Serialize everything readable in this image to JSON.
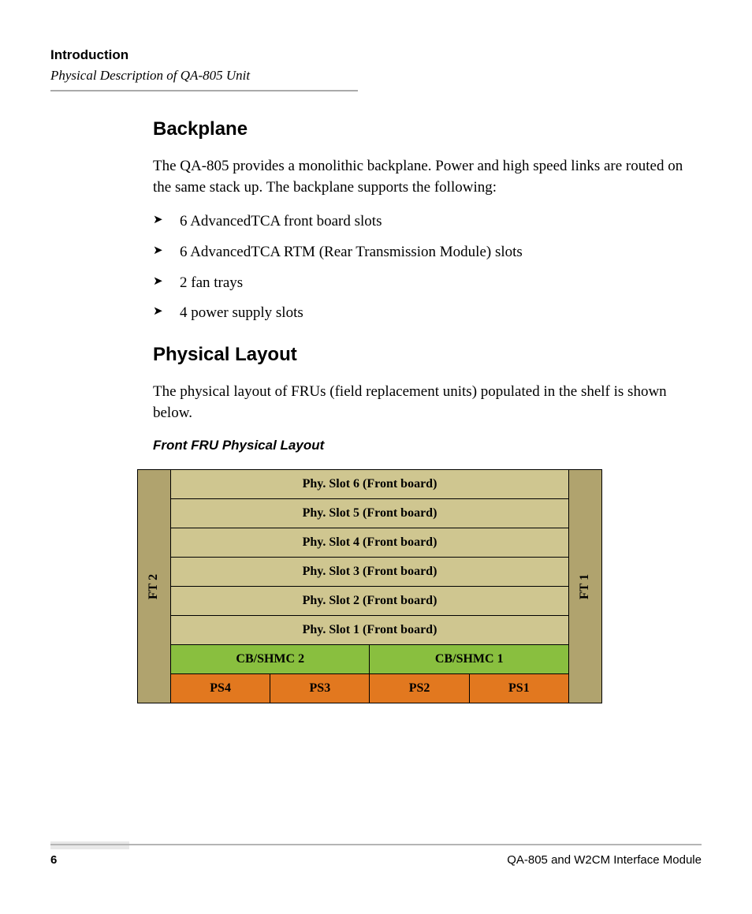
{
  "header": {
    "chapter": "Introduction",
    "subtitle": "Physical Description of QA-805 Unit"
  },
  "sections": {
    "backplane": {
      "title": "Backplane",
      "intro": "The QA-805 provides a monolithic backplane. Power and high speed links are routed on the same stack up. The backplane supports the following:",
      "bullets": [
        "6 AdvancedTCA front board slots",
        "6 AdvancedTCA RTM (Rear Transmission Module) slots",
        "2 fan trays",
        "4 power supply slots"
      ]
    },
    "physical_layout": {
      "title": "Physical Layout",
      "intro": "The physical layout of FRUs (field replacement units) populated in the shelf is shown below.",
      "figure_caption": "Front FRU Physical Layout"
    }
  },
  "diagram": {
    "ft_left": "FT 2",
    "ft_right": "FT 1",
    "slots": [
      "Phy. Slot 6 (Front board)",
      "Phy. Slot 5 (Front board)",
      "Phy. Slot 4 (Front board)",
      "Phy. Slot 3 (Front board)",
      "Phy. Slot 2 (Front board)",
      "Phy. Slot 1 (Front board)"
    ],
    "cb": [
      "CB/SHMC 2",
      "CB/SHMC 1"
    ],
    "ps": [
      "PS4",
      "PS3",
      "PS2",
      "PS1"
    ]
  },
  "footer": {
    "page": "6",
    "doc": "QA-805 and W2CM Interface Module"
  }
}
